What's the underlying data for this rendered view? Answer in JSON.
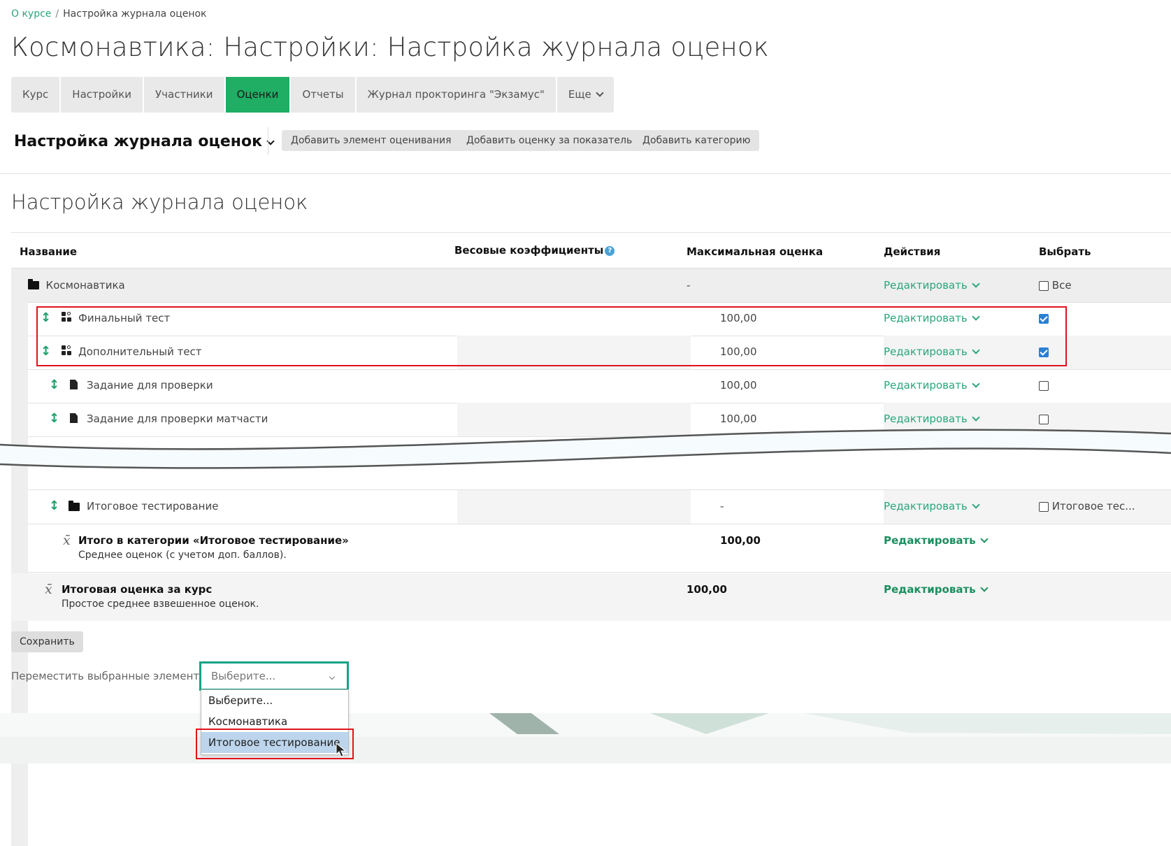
{
  "breadcrumb": {
    "link": "О курсе",
    "separator": "/",
    "current": "Настройка журнала оценок"
  },
  "page_title": "Космонавтика: Настройки: Настройка журнала оценок",
  "tabs": [
    {
      "label": "Курс"
    },
    {
      "label": "Настройки"
    },
    {
      "label": "Участники"
    },
    {
      "label": "Оценки",
      "active": true
    },
    {
      "label": "Отчеты"
    },
    {
      "label": "Журнал прокторинга \"Экзамус\""
    },
    {
      "label": "Еще"
    }
  ],
  "gradebook": {
    "title": "Настройка журнала оценок",
    "buttons": {
      "add_item": "Добавить элемент оценивания",
      "add_outcome": "Добавить оценку за показатель",
      "add_category": "Добавить категорию"
    }
  },
  "section_title": "Настройка журнала оценок",
  "table": {
    "headers": {
      "name": "Название",
      "weights": "Весовые коэффициенты",
      "max": "Максимальная оценка",
      "actions": "Действия",
      "select": "Выбрать"
    },
    "edit_label": "Редактировать",
    "course_row": {
      "name": "Космонавтика",
      "max": "-",
      "select_label": "Все"
    },
    "items": [
      {
        "name": "Финальный тест",
        "max": "100,00",
        "icon": "quiz-icon",
        "checked": true
      },
      {
        "name": "Дополнительный тест",
        "max": "100,00",
        "icon": "quiz-icon",
        "checked": true
      },
      {
        "name": "Задание для проверки",
        "max": "100,00",
        "icon": "assignment-icon",
        "checked": false
      },
      {
        "name": "Задание для проверки матчасти",
        "max": "100,00",
        "icon": "assignment-icon",
        "checked": false
      }
    ],
    "subcategory": {
      "name": "Итоговое тестирование",
      "max": "-",
      "select_label": "Итоговое тес..."
    },
    "category_total": {
      "name": "Итого в категории «Итоговое тестирование»",
      "desc": "Среднее оценок (с учетом доп. баллов).",
      "max": "100,00"
    },
    "course_total": {
      "name": "Итоговая оценка за курс",
      "desc": "Простое среднее взвешенное оценок.",
      "max": "100,00"
    }
  },
  "save_label": "Сохранить",
  "move": {
    "label": "Переместить выбранные элементы в",
    "placeholder": "Выберите...",
    "options": [
      "Выберите...",
      "Космонавтика",
      "Итоговое тестирование"
    ],
    "highlighted": "Итоговое тестирование"
  },
  "colors": {
    "accent": "#2aa57a",
    "active_tab": "#1fae63",
    "highlight": "#e0121d",
    "select_border": "#17a286"
  }
}
